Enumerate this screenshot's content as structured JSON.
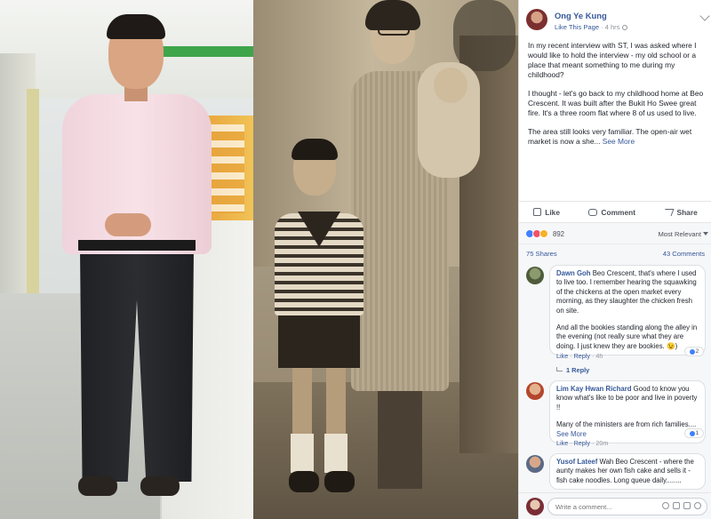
{
  "post": {
    "author": "Ong Ye Kung",
    "like_page": "Like This Page",
    "time": "4 hrs",
    "paragraphs": [
      "In my recent interview with ST, I was asked where I would like to hold the interview - my old school or a place that meant something to me during my childhood?",
      "I thought - let's go back to my childhood home at Beo Crescent. It was built after the Bukit Ho Swee great fire. It's a three room flat where 8 of us used to live.",
      "The area still looks very familiar. The open-air wet market is now a she..."
    ],
    "see_more": "See More"
  },
  "actions": {
    "like": "Like",
    "comment": "Comment",
    "share": "Share"
  },
  "reactions": {
    "count": "892",
    "sort": "Most Relevant"
  },
  "stats": {
    "shares": "75 Shares",
    "comments": "43 Comments"
  },
  "comments": [
    {
      "name": "Dawn Goh",
      "paragraphs": [
        "Beo Crescent, that's where I used to live too. I remember hearing the squawking of the chickens at the open market every morning, as they slaughter the chicken fresh on site.",
        "And all the bookies standing along the alley in the evening (not really sure what they are doing. I just knew they are bookies. 😉)"
      ],
      "like": "Like",
      "reply": "Reply",
      "time": "4h",
      "reactions": "2",
      "replies": "1 Reply"
    },
    {
      "name": "Lim Kay Hwan Richard",
      "paragraphs": [
        "Good to know you know what's like to be poor and live in poverty !!",
        "Many of the ministers are from rich families...."
      ],
      "see_more": "See More",
      "like": "Like",
      "reply": "Reply",
      "time": "20m",
      "reactions": "1"
    },
    {
      "name": "Yusof Lateef",
      "paragraphs": [
        "Wah Beo Crescent - where the aunty makes her own fish cake and sells it - fish cake noodles. Long queue daily........"
      ]
    }
  ],
  "write_comment": {
    "placeholder": "Write a comment..."
  },
  "colors": {
    "link": "#365899",
    "like_reaction": "#4080ff",
    "love_reaction": "#f25268",
    "wow_reaction": "#f7b125"
  },
  "icons": [
    "globe-icon",
    "chevron-down-icon",
    "thumb-icon",
    "comment-icon",
    "share-icon",
    "reply-arrow-icon",
    "camera-icon",
    "gif-icon",
    "sticker-icon",
    "emoji-icon"
  ]
}
